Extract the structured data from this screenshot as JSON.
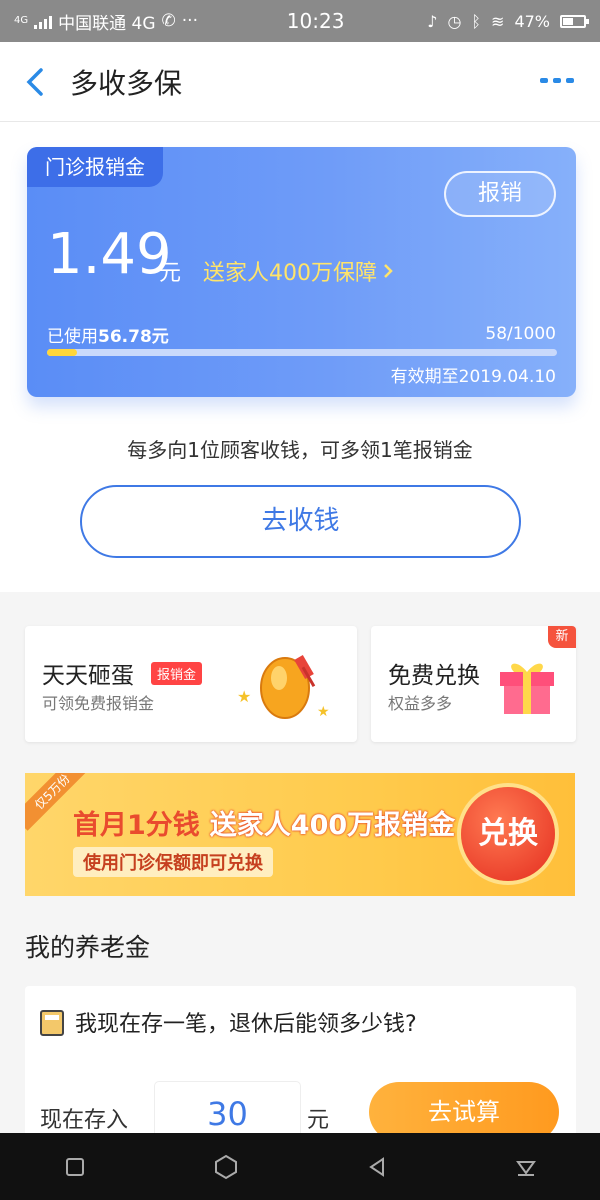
{
  "status_bar": {
    "net": "4G",
    "carrier": "中国联通 4G",
    "time": "10:23",
    "battery": "47%"
  },
  "nav": {
    "title": "多收多保"
  },
  "card": {
    "tag": "门诊报销金",
    "claim_label": "报销",
    "amount": "1.49",
    "unit": "元",
    "promo": "送家人400万保障",
    "used_prefix": "已使用",
    "used_amount": "56.78元",
    "count": "58/1000",
    "progress_percent": 5.8,
    "expire": "有效期至2019.04.10"
  },
  "hint": "每多向1位顾客收钱，可多领1笔报销金",
  "collect_label": "去收钱",
  "features": [
    {
      "title": "天天砸蛋",
      "badge": "报销金",
      "subtitle": "可领免费报销金"
    },
    {
      "title": "免费兑换",
      "subtitle": "权益多多",
      "new": "新"
    }
  ],
  "banner": {
    "ribbon": "仅5万份",
    "main_red": "首月1分钱",
    "main_white": "送家人400万报销金",
    "sub": "使用门诊保额即可兑换",
    "button": "兑换"
  },
  "pension": {
    "section_title": "我的养老金",
    "question": "我现在存一笔，退休后能领多少钱?",
    "save_label": "现在存入",
    "save_value": "30",
    "save_unit": "元",
    "calc_button": "去试算"
  },
  "colors": {
    "accent": "#3f79e5",
    "card_start": "#5a8df6",
    "promo": "#ffe46a",
    "orange": "#ff9a1f"
  }
}
